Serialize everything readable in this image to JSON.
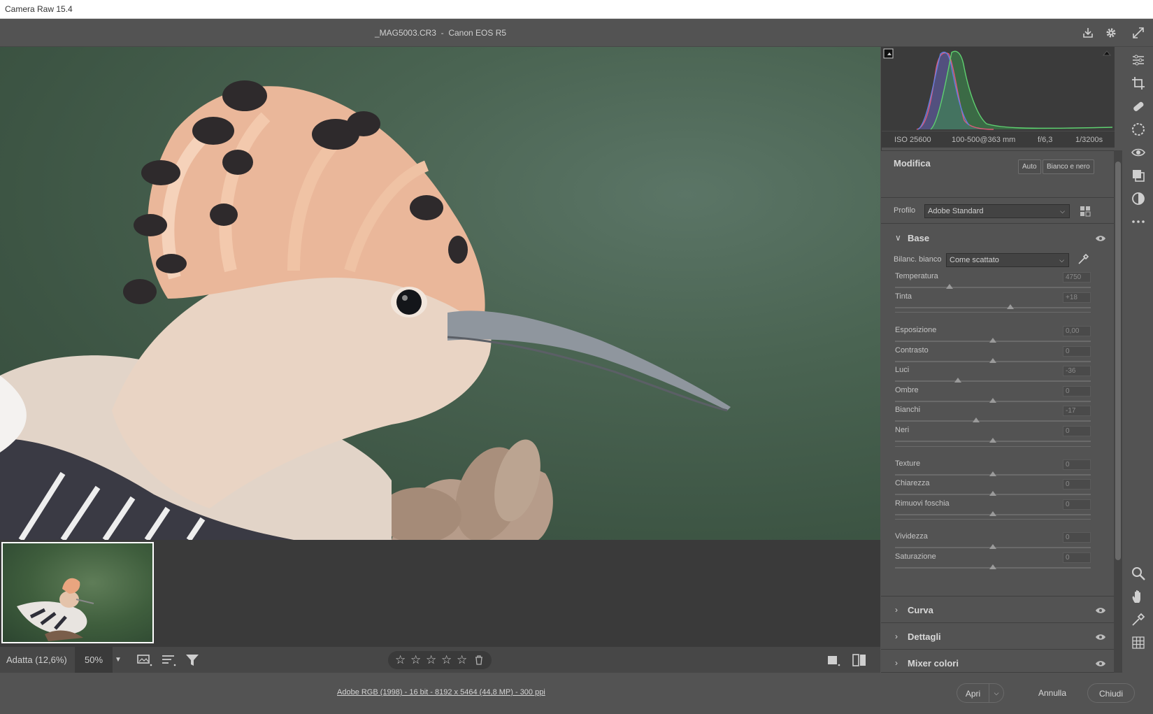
{
  "titlebar": {
    "title": "Camera Raw 15.4"
  },
  "topbar": {
    "filename": "_MAG5003.CR3",
    "separator": "-",
    "camera": "Canon EOS R5"
  },
  "exif": {
    "iso": "ISO 25600",
    "lens": "100-500@363 mm",
    "aperture": "f/6,3",
    "shutter": "1/3200s"
  },
  "modifica": {
    "title": "Modifica",
    "auto_label": "Auto",
    "bw_label": "Bianco e nero"
  },
  "profile": {
    "label": "Profilo",
    "value": "Adobe Standard"
  },
  "base": {
    "title": "Base",
    "wb_label": "Bilanc. bianco",
    "wb_value": "Come scattato",
    "sliders": [
      {
        "label": "Temperatura",
        "value": "4750",
        "pos": 0.28
      },
      {
        "label": "Tinta",
        "value": "+18",
        "pos": 0.59
      },
      {
        "label": "Esposizione",
        "value": "0,00",
        "pos": 0.5
      },
      {
        "label": "Contrasto",
        "value": "0",
        "pos": 0.5
      },
      {
        "label": "Luci",
        "value": "-36",
        "pos": 0.32
      },
      {
        "label": "Ombre",
        "value": "0",
        "pos": 0.5
      },
      {
        "label": "Bianchi",
        "value": "-17",
        "pos": 0.415
      },
      {
        "label": "Neri",
        "value": "0",
        "pos": 0.5
      },
      {
        "label": "Texture",
        "value": "0",
        "pos": 0.5
      },
      {
        "label": "Chiarezza",
        "value": "0",
        "pos": 0.5
      },
      {
        "label": "Rimuovi foschia",
        "value": "0",
        "pos": 0.5
      },
      {
        "label": "Vividezza",
        "value": "0",
        "pos": 0.5
      },
      {
        "label": "Saturazione",
        "value": "0",
        "pos": 0.5
      }
    ]
  },
  "sections": {
    "curva": "Curva",
    "dettagli": "Dettagli",
    "mixer": "Mixer colori"
  },
  "bottombar": {
    "zoom_fit": "Adatta (12,6%)",
    "zoom_value": "50%",
    "stars": [
      "☆",
      "☆",
      "☆",
      "☆",
      "☆"
    ]
  },
  "footer": {
    "info": "Adobe RGB (1998) - 16 bit - 8192 x 5464 (44,8 MP) - 300 ppi",
    "open_label": "Apri",
    "cancel_label": "Annulla",
    "close_label": "Chiudi"
  },
  "colors": {
    "panel": "#535353",
    "histogram_bg": "#3b3b3b",
    "canvas_green": "#4a6452"
  }
}
